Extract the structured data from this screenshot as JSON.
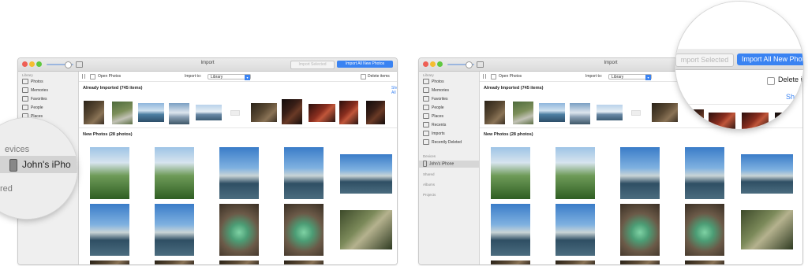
{
  "window": {
    "title": "Import",
    "import_selected_label": "Import Selected",
    "import_all_label": "Import All New Photos"
  },
  "toolbar": {
    "open_photos_label": "Open Photos",
    "import_to_label": "Import to:",
    "import_to_value": "Library",
    "delete_items_label": "Delete items"
  },
  "sidebar": {
    "library_header": "Library",
    "items": [
      {
        "label": "Photos",
        "icon": "photos-icon"
      },
      {
        "label": "Memories",
        "icon": "memories-icon"
      },
      {
        "label": "Favorites",
        "icon": "heart-icon"
      },
      {
        "label": "People",
        "icon": "person-icon"
      },
      {
        "label": "Places",
        "icon": "pin-icon"
      },
      {
        "label": "Recents",
        "icon": "clock-icon"
      },
      {
        "label": "Imports",
        "icon": "import-icon"
      },
      {
        "label": "Recently Deleted",
        "icon": "trash-icon"
      }
    ],
    "devices_header": "Devices",
    "device": "John's iPhone",
    "shared_header": "Shared",
    "albums_header": "Albums",
    "projects_header": "Projects"
  },
  "sections": {
    "already_imported": "Already Imported (745 items)",
    "show_all": "Show All",
    "new_photos": "New Photos (28 photos)"
  },
  "zoom_left": {
    "devices_header": "evices",
    "device": "John's iPho",
    "shared_header": "red"
  },
  "zoom_right": {
    "import_selected": "mport Selected",
    "import_all": "Import All New Photo",
    "delete_items": "Delete ite",
    "show_all": "Sho"
  }
}
